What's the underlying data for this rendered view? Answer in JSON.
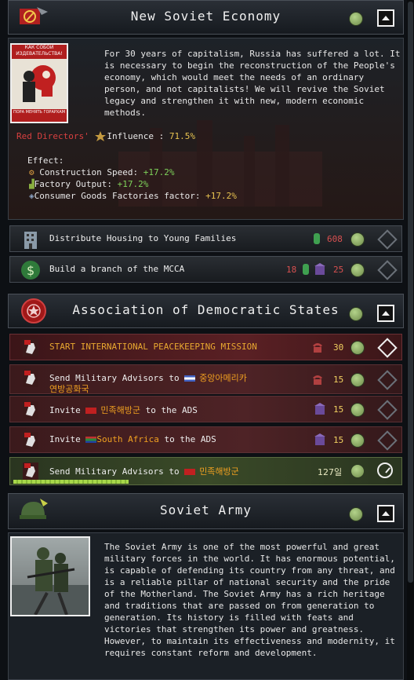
{
  "economy": {
    "title": "New Soviet Economy",
    "description": "For 30 years of capitalism, Russia has suffered a lot. It is necessary to begin the reconstruction of the People's economy, which would meet the needs of an ordinary person, and not capitalists! We will revive the Soviet legacy and strengthen it with new, modern economic methods.",
    "poster_top": "КАК СОБОЙ ИЗДЕВАТЕЛЬСТВА!",
    "poster_bottom": "ПОРА МЕНЯТЬ ГОРАРХАМ",
    "faction": "Red Directors'",
    "influence_label": "Influence : ",
    "influence_value": "71.5%",
    "effect_label": "Effect:",
    "effects": [
      {
        "label": "Construction Speed: ",
        "value": "+17.2%",
        "icon": "gear-icon"
      },
      {
        "label": "Factory Output: ",
        "value": "+17.2%",
        "icon": "factory-icon"
      },
      {
        "label": "Consumer Goods Factories factor: ",
        "value": "+17.2%",
        "icon": "goods-icon"
      }
    ],
    "decisions": [
      {
        "label": "Distribute Housing to Young Families",
        "cost": "608"
      },
      {
        "label": "Build a branch of the MCCA",
        "cost1": "18",
        "cost2": "25"
      }
    ]
  },
  "ads": {
    "title": "Association of Democratic States",
    "decisions": [
      {
        "label": "START INTERNATIONAL PEACEKEEPING MISSION",
        "cost": "30"
      },
      {
        "label_pre": "Send Military Advisors to ",
        "label_country": "중앙아메리카",
        "label_line2": "연방공화국",
        "cost": "15"
      },
      {
        "label_pre": "Invite ",
        "label_country": "민족해방군",
        "label_post": " to the ADS",
        "cost": "15"
      },
      {
        "label_pre": "Invite ",
        "label_country": "South Africa",
        "label_post": " to the ADS",
        "cost": "15"
      },
      {
        "label_pre": "Send Military Advisors to ",
        "label_country": "민족해방군",
        "remaining": "127일",
        "progress": 0.3
      }
    ]
  },
  "army": {
    "title": "Soviet Army",
    "description": "The Soviet Army is one of the most powerful and great military forces in the world. It has enormous potential, is capable of defending its country from any threat, and is a reliable pillar of national security and the pride of the Motherland. The Soviet Army has a rich heritage and traditions that are passed on from generation to generation. Its history is filled with feats and victories that strengthen its power and greatness. However, to maintain its effectiveness and modernity, it requires constant reform and development."
  },
  "colors": {
    "faction_red": "#d84040",
    "effect_green": "#7ed35a",
    "effect_gold": "#e8c350",
    "cost_red": "#d85050",
    "country_orange": "#f0a020",
    "progress_green": "#a8d84a"
  }
}
